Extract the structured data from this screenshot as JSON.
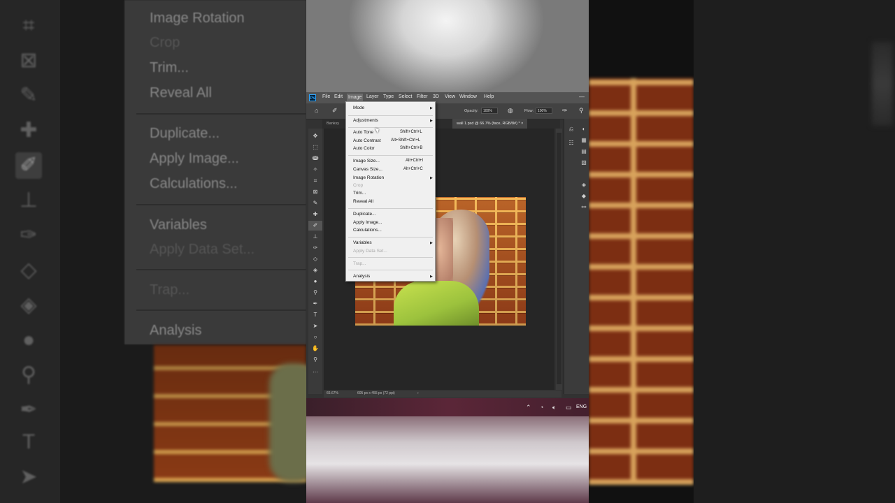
{
  "background_left": {
    "menu_items": [
      "Image Rotation",
      "Crop",
      "Trim...",
      "Reveal All",
      "Duplicate...",
      "Apply Image...",
      "Calculations...",
      "Variables",
      "Apply Data Set...",
      "Trap...",
      "Analysis"
    ]
  },
  "menubar": {
    "logo": "Ps",
    "items": [
      "File",
      "Edit",
      "Image",
      "Layer",
      "Type",
      "Select",
      "Filter",
      "3D",
      "View",
      "Window",
      "Help"
    ],
    "active": "Image",
    "minimize": "—"
  },
  "options_bar": {
    "opacity_label": "Opacity:",
    "opacity_value": "100%",
    "flow_label": "Flow:",
    "flow_value": "100%"
  },
  "tabs": {
    "first": "Banksy",
    "active": "wall 1.psd @ 66.7% (face, RGB/8#) *",
    "close": "×"
  },
  "image_menu": {
    "items": [
      {
        "label": "Mode",
        "submenu": true
      },
      {
        "label": "Adjustments",
        "submenu": true
      },
      {
        "label": "Auto Tone",
        "shortcut": "Shift+Ctrl+L"
      },
      {
        "label": "Auto Contrast",
        "shortcut": "Alt+Shift+Ctrl+L"
      },
      {
        "label": "Auto Color",
        "shortcut": "Shift+Ctrl+B"
      },
      {
        "label": "Image Size...",
        "shortcut": "Alt+Ctrl+I"
      },
      {
        "label": "Canvas Size...",
        "shortcut": "Alt+Ctrl+C"
      },
      {
        "label": "Image Rotation",
        "submenu": true
      },
      {
        "label": "Crop",
        "disabled": true
      },
      {
        "label": "Trim..."
      },
      {
        "label": "Reveal All"
      },
      {
        "label": "Duplicate..."
      },
      {
        "label": "Apply Image..."
      },
      {
        "label": "Calculations..."
      },
      {
        "label": "Variables",
        "submenu": true
      },
      {
        "label": "Apply Data Set...",
        "disabled": true
      },
      {
        "label": "Trap...",
        "disabled": true
      },
      {
        "label": "Analysis",
        "submenu": true
      }
    ]
  },
  "status_bar": {
    "zoom": "66.67%",
    "doc_info": "605 px x 455 px (72 ppi)",
    "arrow": "›"
  },
  "taskbar": {
    "lang": "ENG"
  },
  "colors": {
    "foreground": "#59e38a",
    "background": "#ffffff",
    "menu_bg": "#f0f0f0",
    "ps_chrome": "#323232",
    "taskbar": "#5b2638"
  }
}
